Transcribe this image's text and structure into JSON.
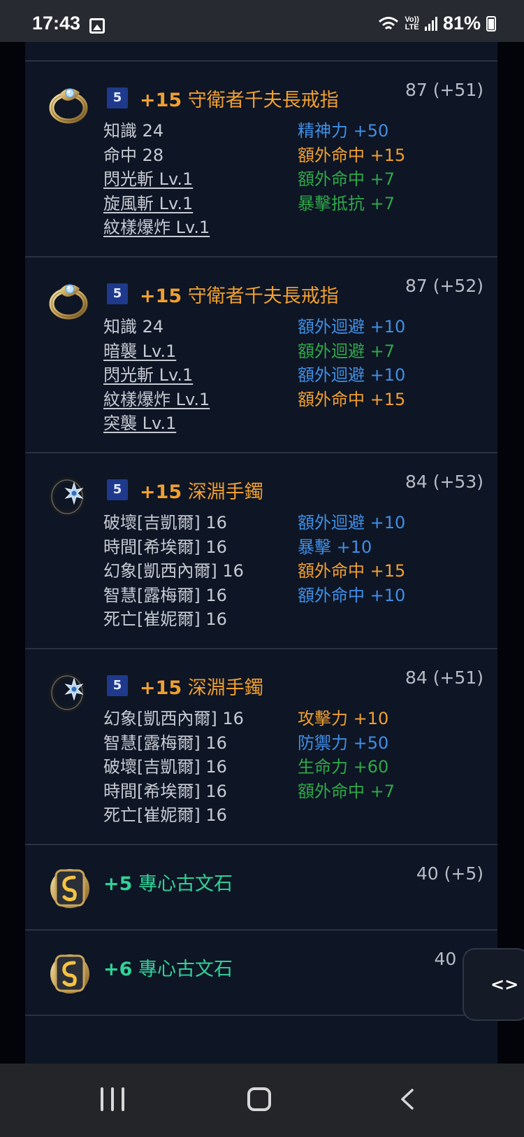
{
  "status_bar": {
    "time": "17:43",
    "network_line1": "Vo))",
    "network_line2": "LTE",
    "battery": "81%"
  },
  "items": [
    {
      "icon": "ring-icon",
      "level": "5",
      "upgrade": "+15",
      "name": "守衛者千夫長戒指",
      "score": "87 (+51)",
      "left": [
        {
          "text": "知識 24",
          "link": false
        },
        {
          "text": "命中 28",
          "link": false
        },
        {
          "text": "閃光斬 Lv.1",
          "link": true
        },
        {
          "text": "旋風斬 Lv.1",
          "link": true
        },
        {
          "text": "紋樣爆炸 Lv.1",
          "link": true
        }
      ],
      "right": [
        {
          "label": "精神力",
          "value": "+50",
          "color": "blue"
        },
        {
          "label": "額外命中",
          "value": "+15",
          "color": "orange"
        },
        {
          "label": "額外命中",
          "value": "+7",
          "color": "green"
        },
        {
          "label": "暴擊抵抗",
          "value": "+7",
          "color": "green"
        }
      ]
    },
    {
      "icon": "ring-icon",
      "level": "5",
      "upgrade": "+15",
      "name": "守衛者千夫長戒指",
      "score": "87 (+52)",
      "left": [
        {
          "text": "知識 24",
          "link": false
        },
        {
          "text": "暗襲 Lv.1",
          "link": true
        },
        {
          "text": "閃光斬 Lv.1",
          "link": true
        },
        {
          "text": "紋樣爆炸 Lv.1",
          "link": true
        },
        {
          "text": "突襲 Lv.1",
          "link": true
        }
      ],
      "right": [
        {
          "label": "額外迴避",
          "value": "+10",
          "color": "blue"
        },
        {
          "label": "額外迴避",
          "value": "+7",
          "color": "green"
        },
        {
          "label": "額外迴避",
          "value": "+10",
          "color": "blue"
        },
        {
          "label": "額外命中",
          "value": "+15",
          "color": "orange"
        }
      ]
    },
    {
      "icon": "bracelet-icon",
      "level": "5",
      "upgrade": "+15",
      "name": "深淵手鐲",
      "score": "84 (+53)",
      "left": [
        {
          "text": "破壞[吉凱爾] 16",
          "link": false
        },
        {
          "text": "時間[希埃爾] 16",
          "link": false
        },
        {
          "text": "幻象[凱西內爾] 16",
          "link": false
        },
        {
          "text": "智慧[露梅爾] 16",
          "link": false
        },
        {
          "text": "死亡[崔妮爾] 16",
          "link": false
        }
      ],
      "right": [
        {
          "label": "額外迴避",
          "value": "+10",
          "color": "blue"
        },
        {
          "label": "暴擊",
          "value": "+10",
          "color": "blue"
        },
        {
          "label": "額外命中",
          "value": "+15",
          "color": "orange"
        },
        {
          "label": "額外命中",
          "value": "+10",
          "color": "blue"
        }
      ]
    },
    {
      "icon": "bracelet-icon",
      "level": "5",
      "upgrade": "+15",
      "name": "深淵手鐲",
      "score": "84 (+51)",
      "left": [
        {
          "text": "幻象[凱西內爾] 16",
          "link": false
        },
        {
          "text": "智慧[露梅爾] 16",
          "link": false
        },
        {
          "text": "破壞[吉凱爾] 16",
          "link": false
        },
        {
          "text": "時間[希埃爾] 16",
          "link": false
        },
        {
          "text": "死亡[崔妮爾] 16",
          "link": false
        }
      ],
      "right": [
        {
          "label": "攻擊力",
          "value": "+10",
          "color": "orange"
        },
        {
          "label": "防禦力",
          "value": "+50",
          "color": "blue"
        },
        {
          "label": "生命力",
          "value": "+60",
          "color": "green"
        },
        {
          "label": "額外命中",
          "value": "+7",
          "color": "green"
        }
      ]
    },
    {
      "icon": "stone-icon",
      "level": "",
      "upgrade": "+5",
      "name": "專心古文石",
      "score": "40 (+5)",
      "left": [],
      "right": []
    },
    {
      "icon": "stone-icon",
      "level": "",
      "upgrade": "+6",
      "name": "專心古文石",
      "score": "40 (+",
      "left": [],
      "right": []
    }
  ],
  "float_button": {
    "label": "<>",
    "icon": "code-icon"
  },
  "colors": {
    "blue": "#3f8fe6",
    "orange": "#f0a030",
    "green": "#2fa84a",
    "stone_name": "#2fd39a"
  }
}
